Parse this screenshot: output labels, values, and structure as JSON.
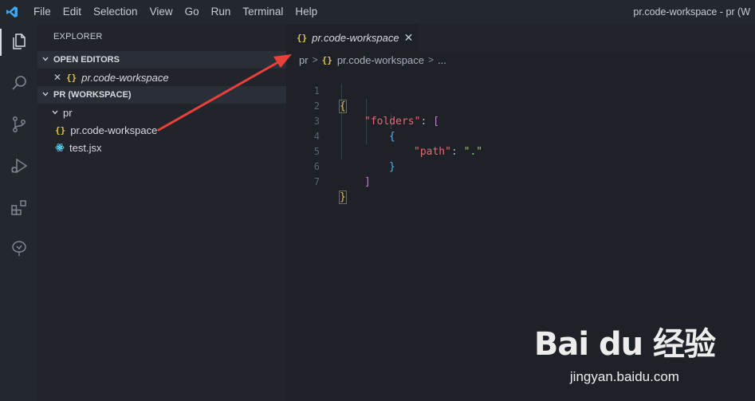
{
  "menu": [
    "File",
    "Edit",
    "Selection",
    "View",
    "Go",
    "Run",
    "Terminal",
    "Help"
  ],
  "window_title": "pr.code-workspace - pr (W",
  "explorer": {
    "title": "EXPLORER",
    "open_editors_header": "OPEN EDITORS",
    "open_editor_close": "✕",
    "open_editor_icon": "{}",
    "open_editor_file": "pr.code-workspace",
    "workspace_header": "PR (WORKSPACE)",
    "folder": "pr",
    "files": [
      {
        "icon": "{}",
        "name": "pr.code-workspace"
      },
      {
        "icon": "react-icon",
        "name": "test.jsx"
      }
    ]
  },
  "tab": {
    "icon": "{}",
    "label": "pr.code-workspace",
    "close": "✕"
  },
  "breadcrumb": {
    "folder": "pr",
    "sep": ">",
    "icon": "{}",
    "file": "pr.code-workspace",
    "more": "..."
  },
  "code": {
    "line_numbers": [
      "1",
      "2",
      "3",
      "4",
      "5",
      "6",
      "7"
    ],
    "l1_brace": "{",
    "l2_key": "\"folders\"",
    "l2_colon": ": ",
    "l2_bracket": "[",
    "l3_brace": "{",
    "l4_key": "\"path\"",
    "l4_colon": ": ",
    "l4_value": "\".\"",
    "l5_brace": "}",
    "l6_bracket": "]",
    "l7_brace": "}"
  },
  "watermark": {
    "logo": "Bai du 经验",
    "url": "jingyan.baidu.com"
  },
  "colors": {
    "annotation_arrow": "#e8413a",
    "brace_yellow": "#e6c24d",
    "key_red": "#e06c75",
    "string_green": "#98c379"
  }
}
